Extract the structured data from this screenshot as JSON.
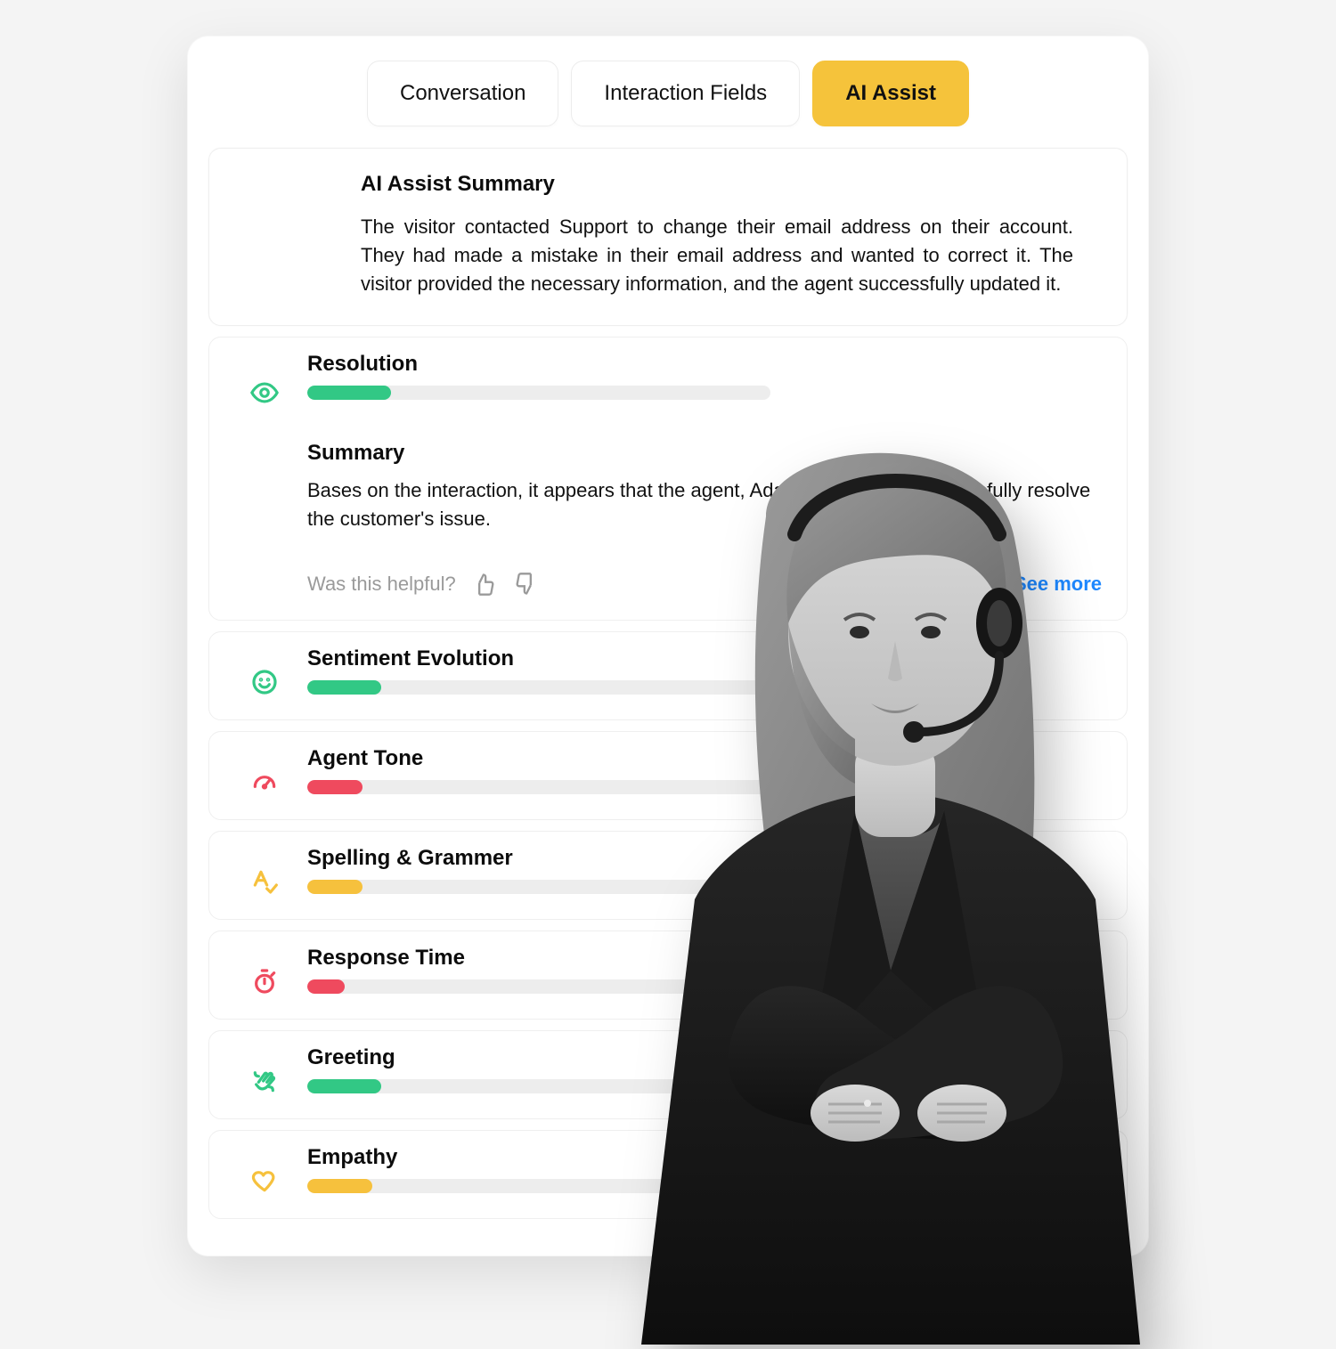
{
  "tabs": {
    "conversation": "Conversation",
    "interaction_fields": "Interaction Fields",
    "ai_assist": "AI Assist"
  },
  "summary": {
    "title": "AI Assist Summary",
    "body": "The visitor contacted Support to change their email address on their account. They had made a mistake in their email address and wanted to correct it. The visitor provided the necessary information, and the agent successfully updated it."
  },
  "resolution": {
    "title": "Resolution",
    "fill_pct": 18,
    "subtitle": "Summary",
    "body": "Bases on the interaction, it appears that the agent, Adam, was able to successfully resolve the customer's issue.",
    "feedback_prompt": "Was this helpful?",
    "see_more": "See more"
  },
  "metrics": [
    {
      "id": "sentiment",
      "label": "Sentiment Evolution",
      "color": "green",
      "fill_pct": 16,
      "icon": "smile-icon",
      "icon_color": "#32c885"
    },
    {
      "id": "tone",
      "label": "Agent Tone",
      "color": "red",
      "fill_pct": 12,
      "icon": "gauge-icon",
      "icon_color": "#ef4a5e"
    },
    {
      "id": "spelling",
      "label": "Spelling & Grammer",
      "color": "yellow",
      "fill_pct": 12,
      "icon": "spellcheck-icon",
      "icon_color": "#f6c13d"
    },
    {
      "id": "response",
      "label": "Response Time",
      "color": "red",
      "fill_pct": 8,
      "icon": "stopwatch-icon",
      "icon_color": "#ef4a5e"
    },
    {
      "id": "greeting",
      "label": "Greeting",
      "color": "green",
      "fill_pct": 16,
      "icon": "wave-icon",
      "icon_color": "#32c885"
    },
    {
      "id": "empathy",
      "label": "Empathy",
      "color": "yellow",
      "fill_pct": 14,
      "icon": "heart-icon",
      "icon_color": "#f6c13d"
    }
  ]
}
